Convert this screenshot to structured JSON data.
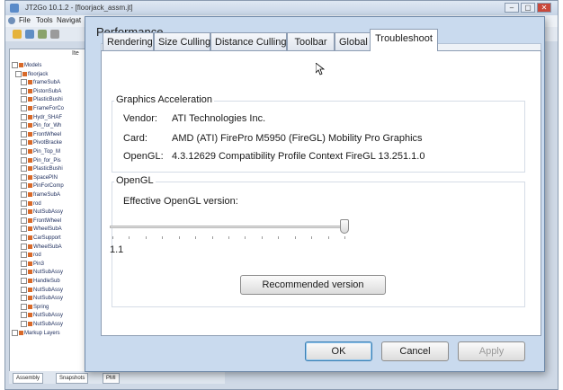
{
  "app": {
    "title": "JT2Go 10.1.2 - [floorjack_assm.jt]",
    "controls": [
      "–",
      "▢",
      "✕"
    ],
    "menu": [
      "File",
      "Tools",
      "Navigat"
    ],
    "tree_header": "Ite",
    "tree_items": [
      "Models",
      "floorjack",
      "frameSubA",
      "PistonSubA",
      "PlasticBushi",
      "FrameForCo",
      "Hydr_SHAF",
      "Pin_for_Wh",
      "FrontWheel",
      "PivotBracke",
      "Pin_Top_M",
      "Pin_for_Pis",
      "PlasticBushi",
      "SpacePIN",
      "PinForComp",
      "frameSubA",
      "rod",
      "NutSubAssy",
      "FrontWheel",
      "WheelSubA",
      "CarSupport",
      "WheelSubA",
      "rod",
      "Pin3",
      "NutSubAssy",
      "HandleSub",
      "NutSubAssy",
      "NutSubAssy",
      "Spring",
      "NutSubAssy",
      "NutSubAssy",
      "Markup Layers"
    ],
    "bottom_tabs": [
      "Assembly",
      "Snapshots",
      "PMI"
    ]
  },
  "dialog": {
    "title": "Performance",
    "tabs": [
      "Rendering",
      "Size Culling",
      "Distance Culling",
      "Toolbar",
      "Global",
      "Troubleshoot"
    ],
    "active_tab": "Troubleshoot",
    "graphics": {
      "label": "Graphics Acceleration",
      "vendor_label": "Vendor:",
      "vendor_value": "ATI Technologies Inc.",
      "card_label": "Card:",
      "card_value": "AMD (ATI) FirePro M5950 (FireGL) Mobility Pro Graphics",
      "opengl_label": "OpenGL:",
      "opengl_value": "4.3.12629 Compatibility Profile Context FireGL 13.251.1.0"
    },
    "opengl": {
      "label": "OpenGL",
      "effective_label": "Effective OpenGL version:",
      "slider_value_text": "1.1",
      "slider_position_fraction": 1.0,
      "recommended_label": "Recommended version"
    },
    "buttons": {
      "ok": "OK",
      "cancel": "Cancel",
      "apply": "Apply"
    }
  }
}
